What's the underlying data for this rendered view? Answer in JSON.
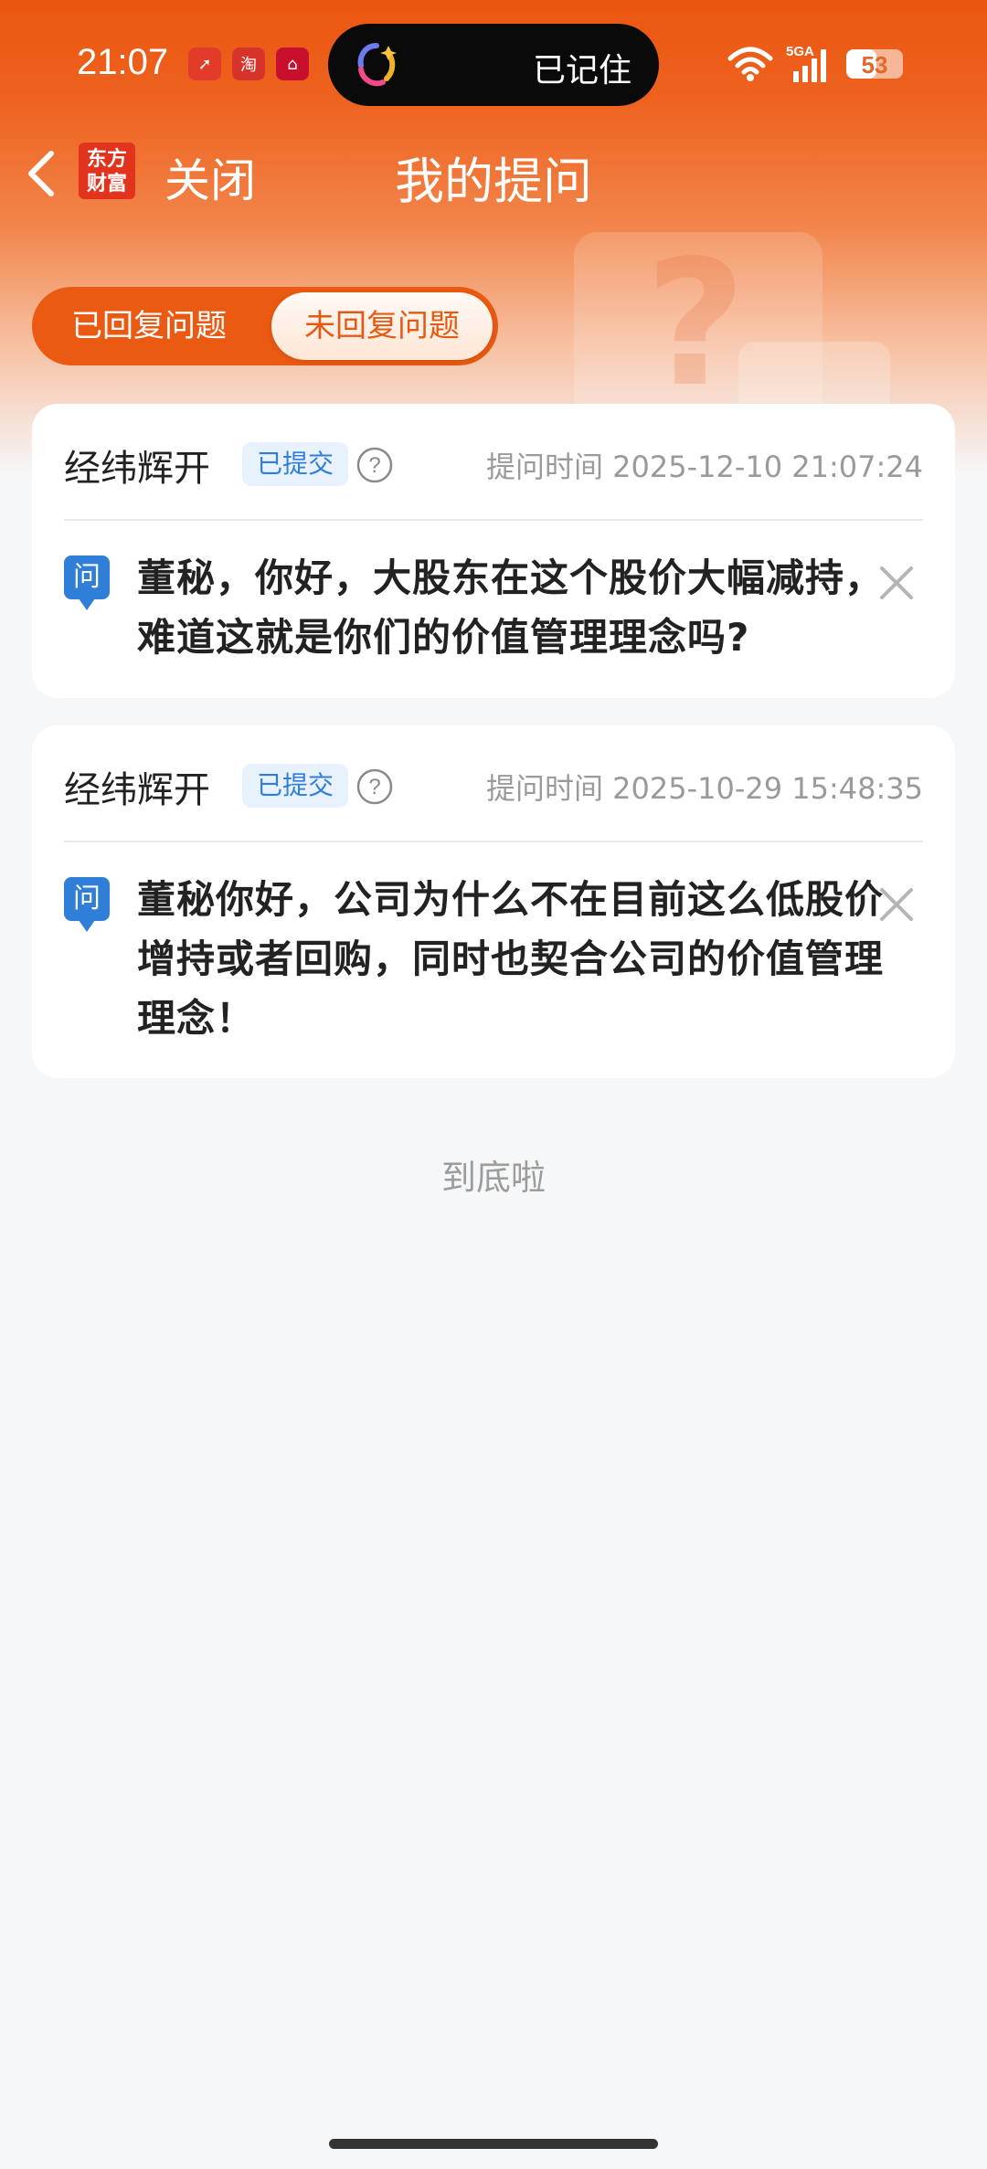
{
  "status_bar": {
    "time": "21:07",
    "notification_icons": [
      "red-arrow-app-icon",
      "ecommerce-app-icon",
      "pos-app-icon"
    ],
    "island_text": "已记住",
    "network": "5GA",
    "battery": "53",
    "battery_level": 0.53
  },
  "nav": {
    "logo_text": "东方财富",
    "close_label": "关闭",
    "title": "我的提问"
  },
  "tabs": [
    {
      "label": "已回复问题",
      "active": false
    },
    {
      "label": "未回复问题",
      "active": true
    }
  ],
  "questions": [
    {
      "company": "经纬辉开",
      "status": "已提交",
      "time": "提问时间 2025-12-10 21:07:24",
      "q_icon": "问",
      "text": "董秘，你好，大股东在这个股价大幅减持，难道这就是你们的价值管理理念吗?"
    },
    {
      "company": "经纬辉开",
      "status": "已提交",
      "time": "提问时间 2025-10-29 15:48:35",
      "q_icon": "问",
      "text": "董秘你好，公司为什么不在目前这么低股价增持或者回购，同时也契合公司的价值管理理念！"
    }
  ],
  "footer": {
    "end_text": "到底啦"
  },
  "colors": {
    "brand_orange": "#ea5610",
    "badge_blue": "#2f7fd8",
    "page_bg": "#f6f7f9"
  }
}
